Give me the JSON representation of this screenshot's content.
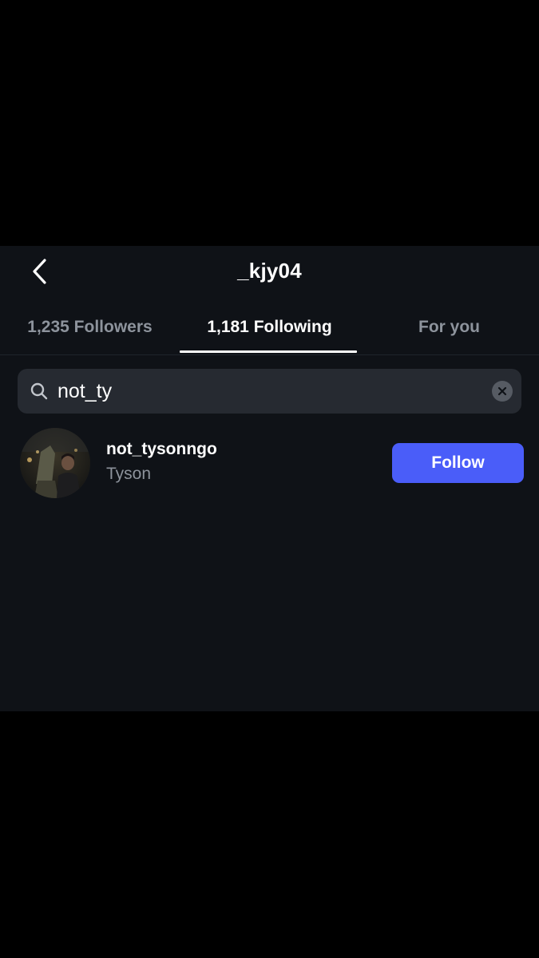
{
  "header": {
    "title": "_kjy04",
    "back_icon": "chevron-left-icon"
  },
  "tabs": [
    {
      "label": "1,235 Followers",
      "active": false
    },
    {
      "label": "1,181 Following",
      "active": true
    },
    {
      "label": "For you",
      "active": false
    }
  ],
  "search": {
    "value": "not_ty",
    "icon": "search-icon",
    "clear_icon": "clear-icon"
  },
  "results": [
    {
      "username": "not_tysonngo",
      "display_name": "Tyson",
      "button_label": "Follow",
      "avatar_icon": "avatar"
    }
  ],
  "colors": {
    "background": "#0f1217",
    "letterbox": "#000000",
    "search_bg": "#262a31",
    "muted_text": "#8d939c",
    "follow_button": "#4a5df9"
  }
}
